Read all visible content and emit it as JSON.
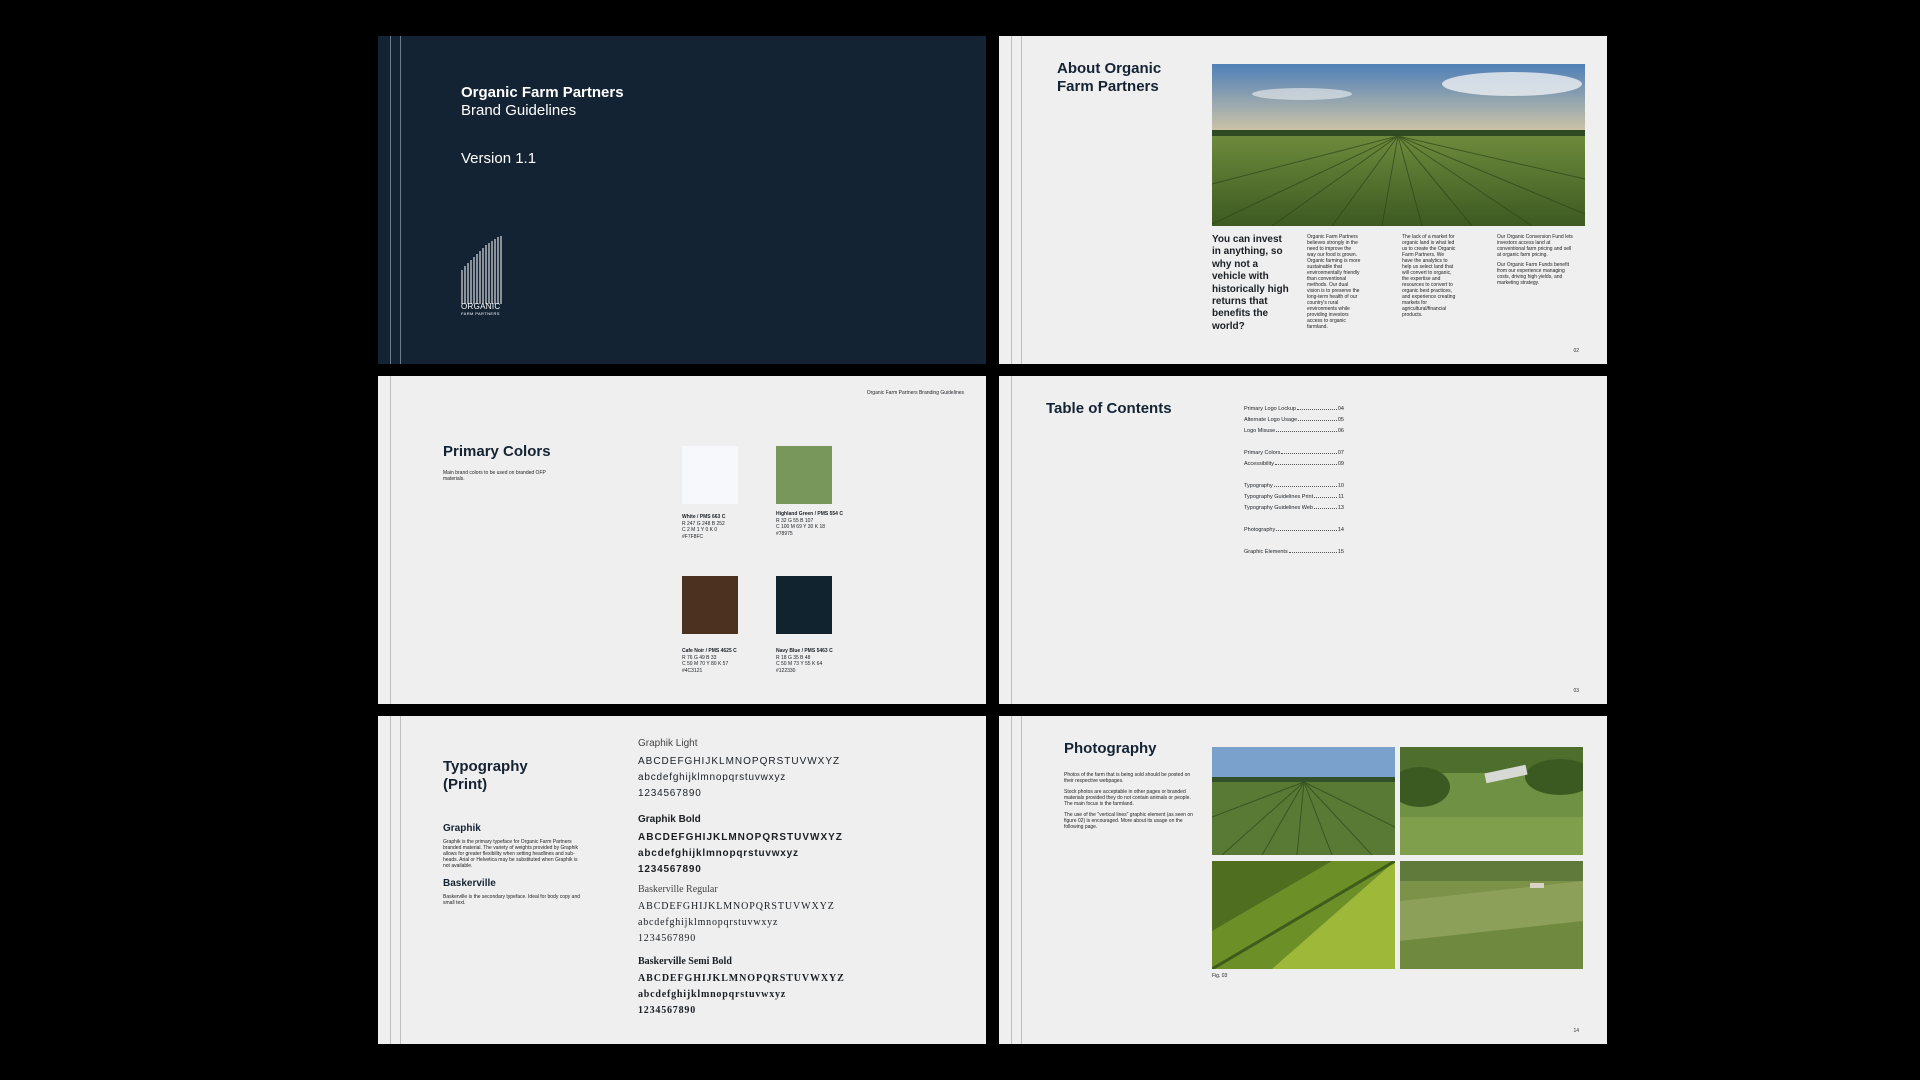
{
  "cover": {
    "title": "Organic Farm Partners",
    "subtitle": "Brand Guidelines",
    "version": "Version 1.1",
    "logo_word": "ORGANIC",
    "logo_sub": "FARM PARTNERS",
    "bg": "#142333"
  },
  "about": {
    "title_line1": "About Organic",
    "title_line2": "Farm Partners",
    "question": "You can invest in anything, so why not a vehicle with historically high returns that benefits the world?",
    "col1": "Organic Farm Partners believes strongly in the need to improve the way our food is grown. Organic farming is more sustainable that environmentally friendly than conventional methods. Our dual vision is to preserve the long-term health of our country's rural environments while providing investors access to organic farmland.",
    "col2": "The lack of a market for organic land is what led us to create the Organic Farm Partners. We have the analytics to help us select land that will convert to organic, the expertise and resources to convert to organic best practices, and experience creating markets for agricultural/financial products.",
    "col3a": "Our Organic Conversion Fund lets investors access land at conventional farm pricing and sell at organic farm pricing.",
    "col3b": "Our Organic Farm Funds benefit from our experience managing costs, driving high yields, and marketing strategy.",
    "page_number": "02"
  },
  "colors": {
    "header": "Organic Farm Partners Branding Guidelines",
    "title": "Primary Colors",
    "desc": "Main brand colors to be used on branded OFP materials.",
    "swatches": [
      {
        "name": "White / PMS 663 C",
        "rgb": "R 247 G 248 B 252",
        "cmyk": "C 2 M 1 Y 0 K 0",
        "hex": "#F7F8FC",
        "color": "#f7f8fc"
      },
      {
        "name": "Highland Green / PMS 554 C",
        "rgb": "R 32 G 55 B 107",
        "cmyk": "C 100 M 69 Y 30 K 18",
        "hex": "#78975",
        "color": "#78975a"
      },
      {
        "name": "Cafe Noir / PMS 4625 C",
        "rgb": "R 76 G 49 B 33",
        "cmyk": "C 50 M 70 Y 80 K 57",
        "hex": "#4C3121",
        "color": "#4c3121"
      },
      {
        "name": "Navy Blue / PMS 5463 C",
        "rgb": "R 18 G 35 B 48",
        "cmyk": "C 50 M 73 Y 55 K 64",
        "hex": "#122330",
        "color": "#122330"
      }
    ]
  },
  "toc": {
    "title": "Table of Contents",
    "items": [
      {
        "label": "Primary Logo Lockup",
        "page": "04"
      },
      {
        "label": "Alternate Logo Usage",
        "page": "05"
      },
      {
        "label": "Logo Misuse",
        "page": "06"
      },
      {
        "label": "Primary Colors",
        "page": "07"
      },
      {
        "label": "Accessibility",
        "page": "09"
      },
      {
        "label": "Typography",
        "page": "10"
      },
      {
        "label": "Typography Guidelines Print",
        "page": "11"
      },
      {
        "label": "Typography Guidelines Web",
        "page": "13"
      },
      {
        "label": "Photography",
        "page": "14"
      },
      {
        "label": "Graphic Elements",
        "page": "15"
      }
    ],
    "page_number": "03"
  },
  "typography": {
    "title_line1": "Typography",
    "title_line2": "(Print)",
    "graphik_heading": "Graphik",
    "graphik_desc": "Graphik is the primary typeface for Organic Farm Partners branded material. The variety of weights provided by Graphik allows for greater flexibility when setting headlines and sub-heads. Arial or Helvetica may be substituted when Graphik is not available.",
    "baskerville_heading": "Baskerville",
    "baskerville_desc": "Baskerville is the secondary typeface. Ideal for body copy and small text.",
    "graphik_light": "Graphik Light",
    "graphik_bold": "Graphik Bold",
    "bask_regular": "Baskerville Regular",
    "bask_semibold": "Baskerville Semi Bold",
    "upper": "ABCDEFGHIJKLMNOPQRSTUVWXYZ",
    "lower": "abcdefghijklmnopqrstuvwxyz",
    "digits": "1234567890"
  },
  "photography": {
    "title": "Photography",
    "p1": "Photos of the farm that is being sold should be posted on their respective webpages.",
    "p2": "Stock photos are acceptable in other pages or branded materials provided they do not contain animals or people. The main focus is the farmland.",
    "p3": "The use of the \"vertical lines\" graphic element (as seen on figure 02) is encouraged. More about its usage on the following page.",
    "caption": "Fig. 03",
    "page_number": "14"
  }
}
